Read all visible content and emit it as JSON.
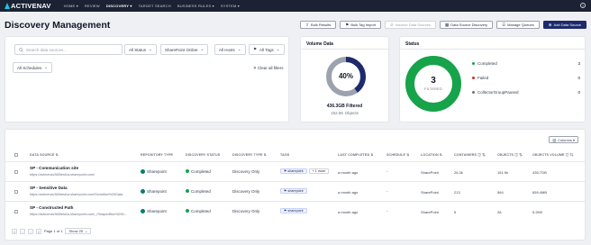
{
  "brand": {
    "name": "ACTIVENAV",
    "accent": "#22c1e6"
  },
  "nav": {
    "items": [
      "HOME ▾",
      "REVIEW",
      "DISCOVERY ▾",
      "TARGET SEARCH",
      "BUSINESS RULES ▾",
      "SYSTEM ▾"
    ],
    "active_index": 2,
    "help": "?"
  },
  "header": {
    "title": "Discovery Management",
    "buttons": [
      {
        "label": "Bulk Results",
        "icon": "upload-icon"
      },
      {
        "label": "Bulk Tag Import",
        "icon": "tag-icon"
      },
      {
        "label": "Inactive Data Sources",
        "icon": "inactive-icon",
        "disabled": true
      },
      {
        "label": "Data Source Discovery",
        "icon": "discovery-icon"
      },
      {
        "label": "Manage Queues",
        "icon": "list-icon"
      },
      {
        "label": "Add Data Source",
        "icon": "plus-icon",
        "primary": true
      }
    ]
  },
  "filters": {
    "search_placeholder": "Search data sources...",
    "all_status": "All Status",
    "sharepoint_online": "SharePoint Online",
    "all_hosts": "All Hosts",
    "all_tags": "All Tags",
    "all_schedules": "All Schedules",
    "clear_all": "Clear all filters"
  },
  "volume": {
    "title": "Volume Data",
    "percent_label": "40%",
    "percent": 40,
    "filtered_label": "436.3GB Filtered",
    "objects_label": "152.5K Objects",
    "colors": {
      "filled": "#1e2a6b",
      "track": "#9ca3af"
    }
  },
  "status": {
    "title": "Status",
    "center_number": "3",
    "center_label": "FILTERED",
    "ring_color": "#16a34a",
    "items": [
      {
        "label": "Completed",
        "count": "3",
        "color": "#16a34a"
      },
      {
        "label": "Failed",
        "count": "0",
        "color": "#dc2626"
      },
      {
        "label": "CollectorGroupPaused",
        "count": "0",
        "color": "#6b7280"
      }
    ]
  },
  "table": {
    "columns_button": "Columns ▾",
    "headers": {
      "data_source": "DATA SOURCE ⇅",
      "repository_type": "REPOSITORY TYPE",
      "discovery_status": "DISCOVERY STATUS",
      "discovery_type": "DISCOVERY TYPE ⇅",
      "tags": "TAGS",
      "last_completed": "LAST COMPLETED ⇅",
      "schedule": "SCHEDULE ⇅",
      "location": "LOCATION ⇅",
      "containers": "CONTAINERS ⓘ ⇅",
      "objects": "OBJECTS ⓘ ⇅",
      "objects_volume": "OBJECTS VOLUME ⓘ ⇅"
    },
    "rows": [
      {
        "name": "SP - Communication site",
        "url": "https://activenav365test1a.sharepoint.com/",
        "repository": "Sharepoint",
        "status": "Completed",
        "type": "Discovery Only",
        "tag": "sharepoint",
        "more": "+ 1 more",
        "last_completed": "a month ago",
        "schedule": "-",
        "location": "SharePoint",
        "containers": "26.3k",
        "objects": "151.9k",
        "volume": "435.7GB"
      },
      {
        "name": "SP - Sensitive Data",
        "url": "https://activenav365test1a.sharepoint.com/Sensitive%20Data",
        "repository": "Sharepoint",
        "status": "Completed",
        "type": "Discovery Only",
        "tag": "sharepoint",
        "more": "",
        "last_completed": "a month ago",
        "schedule": "-",
        "location": "SharePoint",
        "containers": "213",
        "objects": "564",
        "volume": "659.4MB"
      },
      {
        "name": "SP - Constructed Path",
        "url": "https://activenav365test1a.sharepoint.com/_/ShapedBox%250...",
        "repository": "Sharepoint",
        "status": "Completed",
        "type": "Discovery Only",
        "tag": "sharepoint",
        "more": "",
        "last_completed": "a month ago",
        "schedule": "-",
        "location": "SharePoint",
        "containers": "5",
        "objects": "28",
        "volume": "5.2KB"
      }
    ]
  },
  "pager": {
    "first": "«",
    "prev": "‹",
    "next": "›",
    "last": "»",
    "page_label": "Page 1 of 1",
    "show_label": "Show 25"
  }
}
